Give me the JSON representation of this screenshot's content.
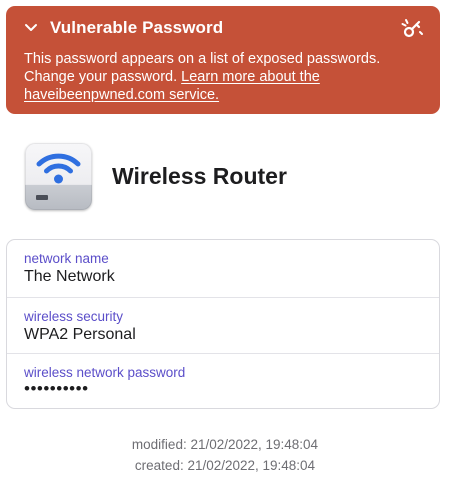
{
  "banner": {
    "title": "Vulnerable Password",
    "message": "This password appears on a list of exposed passwords. Change your password. ",
    "link": "Learn more about the haveibeenpwned.com service.",
    "color": "#c55138",
    "icons": {
      "collapse": "chevron-down-icon",
      "action": "key-warning-icon"
    }
  },
  "item": {
    "title": "Wireless Router",
    "icon": "wireless-router-icon",
    "icon_accent": "#2f6fe0"
  },
  "fields": [
    {
      "label": "network name",
      "value": "The Network"
    },
    {
      "label": "wireless security",
      "value": "WPA2 Personal"
    },
    {
      "label": "wireless network password",
      "value": "••••••••••"
    }
  ],
  "label_color": "#5b4ec9",
  "metadata": {
    "modified": "modified: 21/02/2022, 19:48:04",
    "created": "created: 21/02/2022, 19:48:04"
  }
}
